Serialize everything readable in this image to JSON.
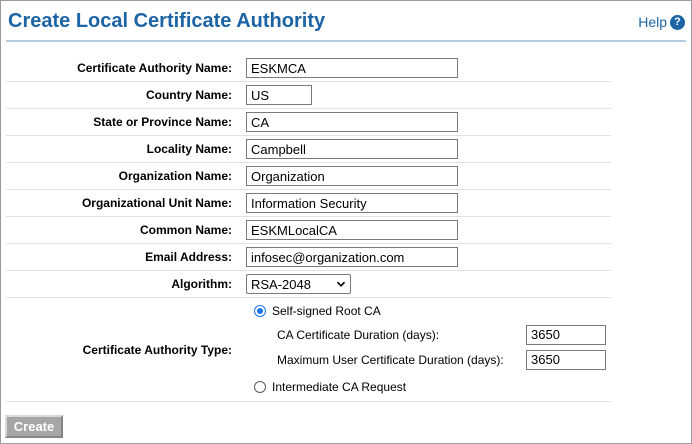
{
  "header": {
    "title": "Create Local Certificate Authority",
    "help_label": "Help",
    "help_icon": "?"
  },
  "form": {
    "fields": [
      {
        "label": "Certificate Authority Name:",
        "value": "ESKMCA"
      },
      {
        "label": "Country Name:",
        "value": "US"
      },
      {
        "label": "State or Province Name:",
        "value": "CA"
      },
      {
        "label": "Locality Name:",
        "value": "Campbell"
      },
      {
        "label": "Organization Name:",
        "value": "Organization"
      },
      {
        "label": "Organizational Unit Name:",
        "value": "Information Security"
      },
      {
        "label": "Common Name:",
        "value": "ESKMLocalCA"
      },
      {
        "label": "Email Address:",
        "value": "infosec@organization.com"
      }
    ],
    "algorithm": {
      "label": "Algorithm:",
      "selected": "RSA-2048"
    },
    "ca_type": {
      "label": "Certificate Authority Type:",
      "self_signed": {
        "label": "Self-signed Root CA",
        "checked": true
      },
      "ca_duration": {
        "label": "CA Certificate Duration (days):",
        "value": "3650"
      },
      "user_duration": {
        "label": "Maximum User Certificate Duration (days):",
        "value": "3650"
      },
      "intermediate": {
        "label": "Intermediate CA Request",
        "checked": false
      }
    }
  },
  "actions": {
    "create_label": "Create"
  },
  "colors": {
    "title": "#1d64a6",
    "radio_accent": "#1a73e8",
    "button_disabled": "#a6a6a6"
  }
}
